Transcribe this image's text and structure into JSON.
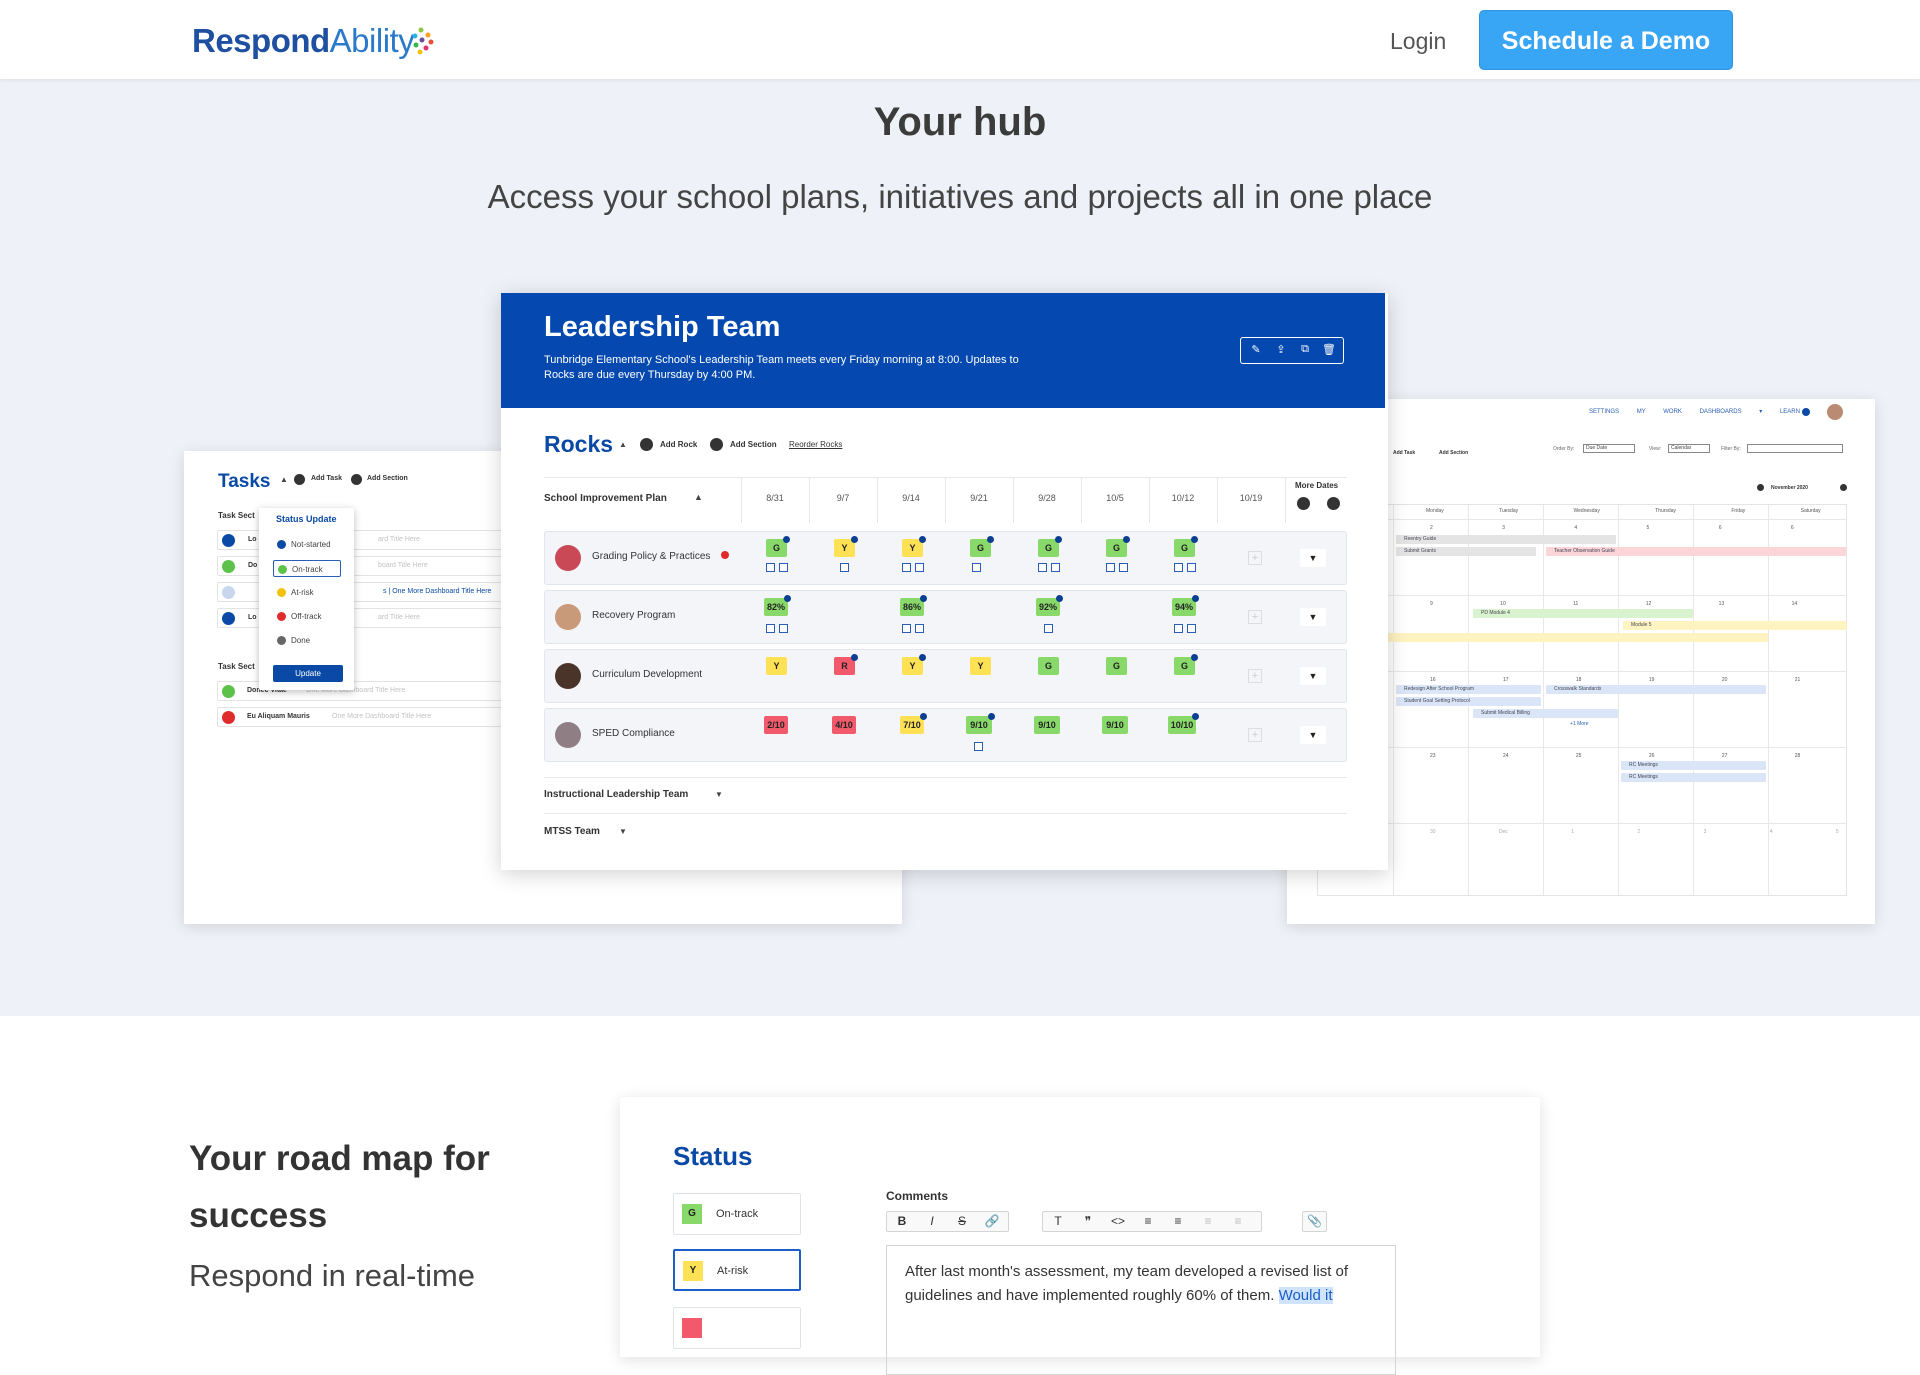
{
  "header": {
    "logo_bold": "Respond",
    "logo_light": "Ability",
    "login_label": "Login",
    "demo_label": "Schedule a Demo"
  },
  "hub": {
    "title": "Your hub",
    "subtitle": "Access your school plans, initiatives and projects all in one place"
  },
  "tasks": {
    "title": "Tasks",
    "add_task": "Add Task",
    "add_section": "Add Section",
    "section_label": "Task Sect",
    "rows": [
      {
        "icon": "Lo",
        "text": "ard Title Here"
      },
      {
        "icon": "Do",
        "text": "board Title Here"
      },
      {
        "icon": "",
        "text": "s | One More Dashboard Title Here"
      },
      {
        "icon": "Lo",
        "text": "ard Title Here"
      }
    ],
    "popup": {
      "title": "Status Update",
      "options": [
        "Not-started",
        "On-track",
        "At-risk",
        "Off-track",
        "Done"
      ],
      "update": "Update"
    },
    "section2_label": "Task Sect",
    "rows2": [
      {
        "name": "Donec Vitae",
        "text": "One More Dashboard Title Here"
      },
      {
        "name": "Eu Aliquam Mauris",
        "text": "One More Dashboard Title Here"
      }
    ]
  },
  "leadership": {
    "title": "Leadership Team",
    "description": "Tunbridge Elementary School's Leadership Team meets every Friday morning at 8:00. Updates to Rocks are due every Thursday by 4:00 PM.",
    "rocks_title": "Rocks",
    "add_rock": "Add Rock",
    "add_section": "Add Section",
    "reorder": "Reorder Rocks",
    "plan_label": "School Improvement Plan",
    "dates": [
      "8/31",
      "9/7",
      "9/14",
      "9/21",
      "9/28",
      "10/5",
      "10/12",
      "10/19"
    ],
    "more_dates": "More Dates",
    "rows": [
      {
        "label": "Grading Policy & Practices",
        "cells": [
          "G",
          "Y",
          "Y",
          "G",
          "G",
          "G",
          "G"
        ]
      },
      {
        "label": "Recovery Program",
        "cells": [
          "82%",
          "",
          "86%",
          "",
          "92%",
          "",
          "94%"
        ]
      },
      {
        "label": "Curriculum Development",
        "cells": [
          "Y",
          "R",
          "Y",
          "Y",
          "G",
          "G",
          "G"
        ]
      },
      {
        "label": "SPED Compliance",
        "cells": [
          "2/10",
          "4/10",
          "7/10",
          "9/10",
          "9/10",
          "9/10",
          "10/10"
        ]
      }
    ],
    "groups": [
      "Instructional Leadership Team",
      "MTSS Team"
    ]
  },
  "calendar": {
    "nav": [
      "SETTINGS",
      "MY WORK",
      "DASHBOARDS ▾",
      "LEARN"
    ],
    "add_task": "Add Task",
    "add_section": "Add Section",
    "order_by": "Order By:",
    "order_val": "Due Date",
    "view": "View:",
    "view_val": "Calendar",
    "filter": "Filter By:",
    "month": "November 2020",
    "days": [
      "Monday",
      "Tuesday",
      "Wednesday",
      "Thursday",
      "Friday",
      "Saturday"
    ],
    "dates": [
      [
        "2",
        "3",
        "4",
        "5",
        "6",
        "6"
      ],
      [
        "9",
        "10",
        "11",
        "12",
        "13",
        "14"
      ],
      [
        "16",
        "17",
        "18",
        "19",
        "20",
        "21"
      ],
      [
        "23",
        "24",
        "25",
        "26",
        "27",
        "28"
      ],
      [
        "30",
        "Dec 1",
        "2",
        "3",
        "4",
        "5"
      ]
    ],
    "events": [
      "Reentry Guide",
      "Submit Grants",
      "Teacher Observation Guide",
      "PD Module 4",
      "Module 5",
      "Redesign After School Program",
      "Crosswalk Standards",
      "Student Goal Setting Protocol",
      "Submit Medical Billing",
      "+1 More",
      "RC Meetings",
      "RC Meetings"
    ]
  },
  "roadmap": {
    "title": "Your road map for success",
    "text": "Respond in real-time"
  },
  "status": {
    "title": "Status",
    "options": [
      {
        "code": "G",
        "label": "On-track"
      },
      {
        "code": "Y",
        "label": "At-risk"
      }
    ],
    "comments_label": "Comments",
    "toolbar": [
      "B",
      "I",
      "S",
      "🔗",
      "T",
      "❞",
      "<>",
      "≡",
      "≡",
      "≡",
      "≡",
      "📎"
    ],
    "comment_text": "After last month's assessment, my team developed a revised list of guidelines and have implemented roughly 60% of them. ",
    "comment_selected": "Would it"
  },
  "colors": {
    "brand": "#0549b0",
    "accent": "#39a5f5",
    "green": "#89d96a",
    "yellow": "#ffe155",
    "red": "#f25a6b"
  }
}
